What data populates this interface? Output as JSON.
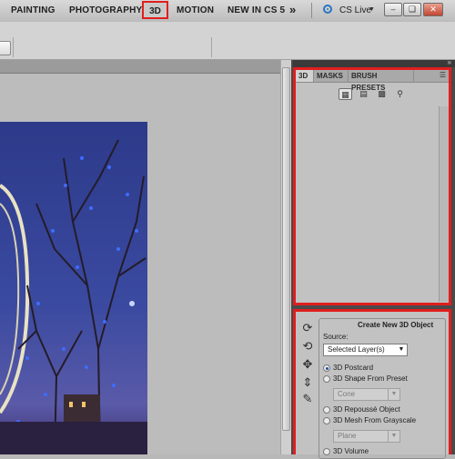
{
  "workspace_bar": {
    "tabs": [
      "PAINTING",
      "PHOTOGRAPHY",
      "3D",
      "MOTION",
      "NEW IN CS 5"
    ],
    "selected_tab": "3D",
    "overflow_icon": "double-chevron-right-icon",
    "cs_live": "CS Live",
    "window_controls": {
      "minimize": "minimize-icon",
      "restore": "restore-icon",
      "close": "close-icon"
    }
  },
  "panel_3d": {
    "tabs": [
      "3D",
      "MASKS",
      "BRUSH PRESETS"
    ],
    "active_tab": "3D",
    "tools": [
      "scene-filter-icon",
      "mesh-filter-icon",
      "material-filter-icon",
      "light-filter-icon"
    ],
    "selected_tool": "scene-filter-icon"
  },
  "create_panel": {
    "title": "Create New 3D Object",
    "source_label": "Source:",
    "source_value": "Selected Layer(s)",
    "options": [
      "3D Postcard",
      "3D Shape From Preset",
      "3D Repoussé Object",
      "3D Mesh From Grayscale",
      "3D Volume"
    ],
    "selected_option": "3D Postcard",
    "shape_preset_value": "Cone",
    "grayscale_mesh_value": "Plane"
  },
  "colors": {
    "highlight_border": "#e01e1e",
    "panel_bg": "#c2c2c2",
    "dock_bg": "#4a4a4a"
  }
}
